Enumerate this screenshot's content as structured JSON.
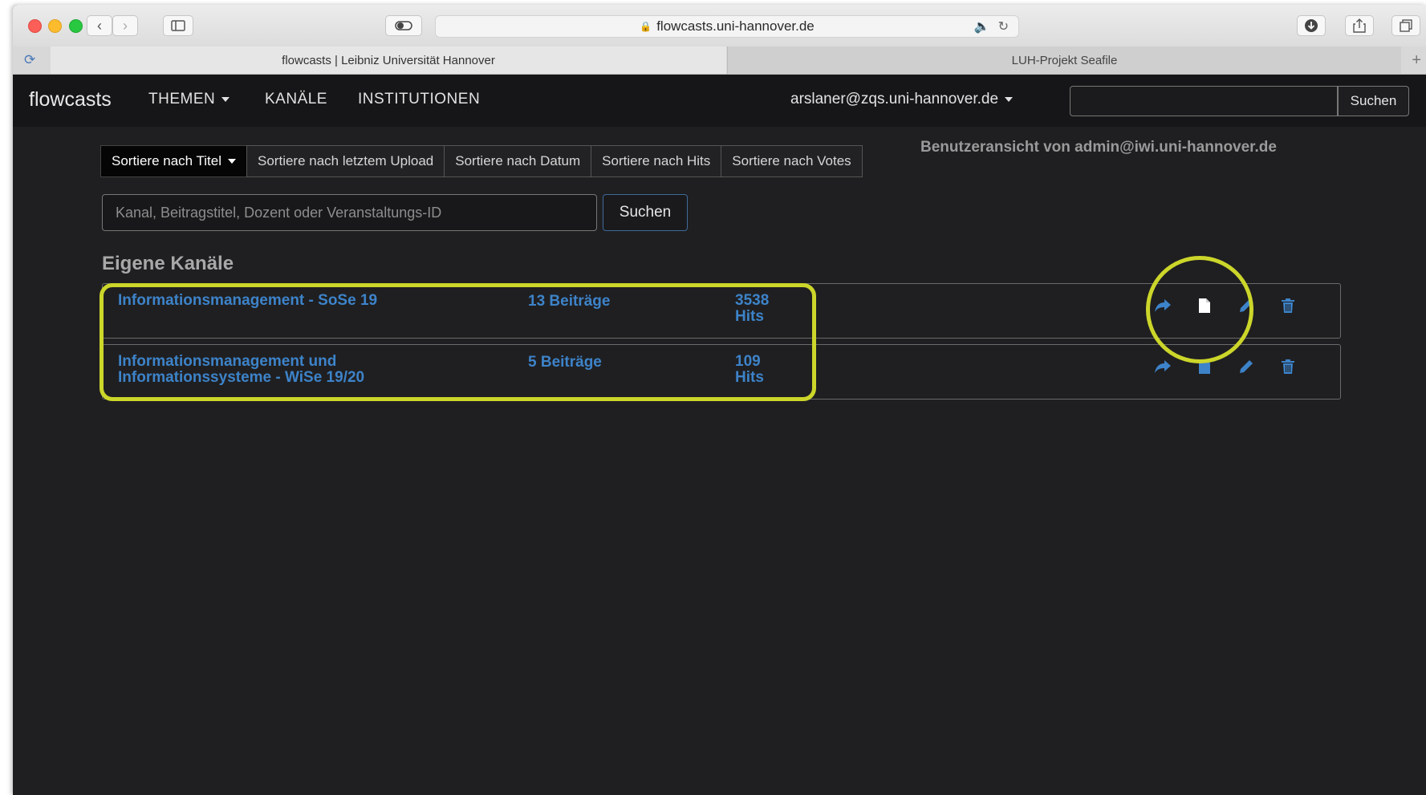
{
  "browser": {
    "url": "flowcasts.uni-hannover.de",
    "tabs": [
      {
        "label": "flowcasts | Leibniz Universität Hannover",
        "active": true
      },
      {
        "label": "LUH-Projekt Seafile",
        "active": false
      }
    ],
    "new_tab": "+"
  },
  "navbar": {
    "brand": "flowcasts",
    "items": [
      {
        "label": "THEMEN",
        "dropdown": true
      },
      {
        "label": "KANÄLE",
        "dropdown": false
      },
      {
        "label": "INSTITUTIONEN",
        "dropdown": false
      }
    ],
    "user": "arslaner@zqs.uni-hannover.de",
    "search_button": "Suchen"
  },
  "sort_buttons": [
    {
      "label": "Sortiere nach Titel",
      "active": true
    },
    {
      "label": "Sortiere nach letztem Upload",
      "active": false
    },
    {
      "label": "Sortiere nach Datum",
      "active": false
    },
    {
      "label": "Sortiere nach Hits",
      "active": false
    },
    {
      "label": "Sortiere nach Votes",
      "active": false
    }
  ],
  "admin_view": "Benutzeransicht von admin@iwi.uni-hannover.de",
  "search": {
    "placeholder": "Kanal, Beitragstitel, Dozent oder Veranstaltungs-ID",
    "button": "Suchen"
  },
  "section_heading": "Eigene Kanäle",
  "channels": [
    {
      "title": "Informationsmanagement - SoSe 19",
      "count": "13 Beiträge",
      "hits": "3538 Hits"
    },
    {
      "title": "Informationsmanagement und Informationssysteme - WiSe 19/20",
      "count": "5 Beiträge",
      "hits": "109 Hits"
    }
  ],
  "icons": {
    "share": "share-icon",
    "document": "document-icon",
    "edit": "pencil-icon",
    "delete": "trash-icon"
  },
  "colors": {
    "page_bg": "#1f1f21",
    "navbar_bg": "#161618",
    "link_blue": "#3d83c9",
    "highlight": "#ccd62a"
  }
}
